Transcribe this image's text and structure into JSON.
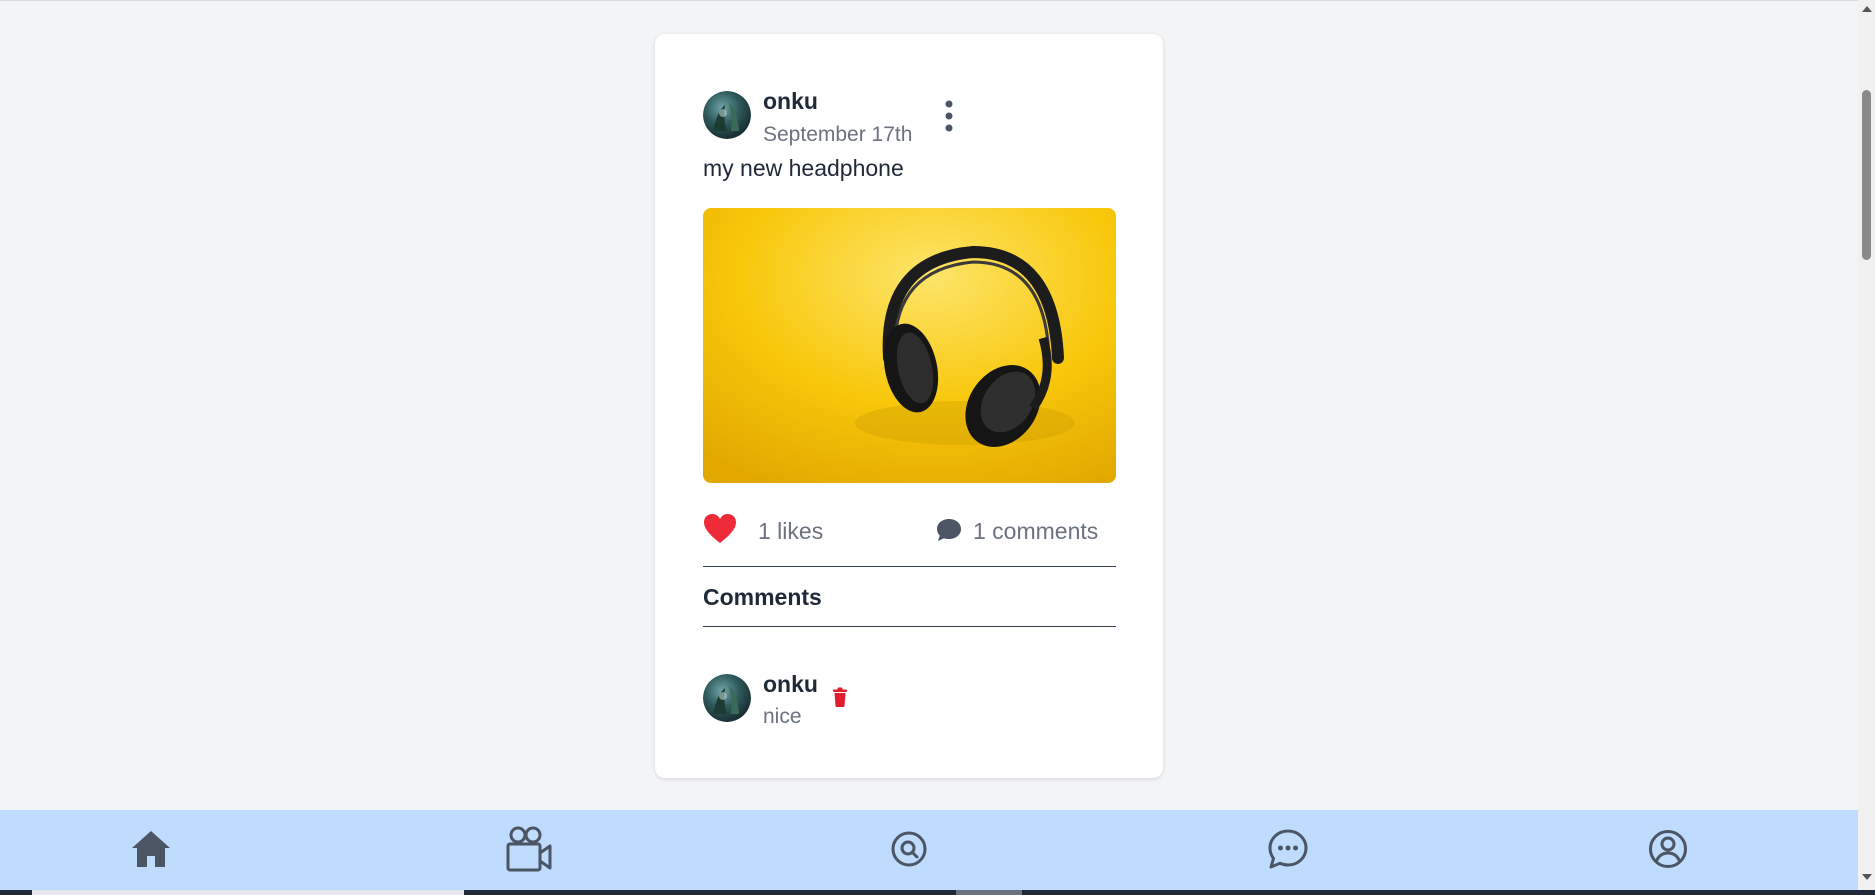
{
  "post": {
    "author": "onku",
    "date": "September 17th",
    "caption": "my new headphone",
    "image_subject": "black headphones on yellow background",
    "likes_label": "1 likes",
    "comments_label": "1 comments",
    "liked": true
  },
  "comments_section": {
    "heading": "Comments",
    "items": [
      {
        "author": "onku",
        "text": "nice"
      }
    ]
  },
  "icons": {
    "menu": "kebab-menu-icon",
    "like": "heart-icon",
    "comment": "speech-bubble-icon",
    "delete": "trash-icon",
    "nav_home": "home-icon",
    "nav_videos": "video-camera-icon",
    "nav_search": "search-icon",
    "nav_messages": "chat-bubble-icon",
    "nav_profile": "user-circle-icon"
  },
  "colors": {
    "page_bg": "#f3f4f6",
    "card_bg": "#ffffff",
    "nav_bg": "#bfdbfe",
    "like_red": "#ef2b3a",
    "delete_red": "#e11d2e",
    "icon_gray": "#4b5563",
    "image_yellow": "#f8c70a"
  }
}
